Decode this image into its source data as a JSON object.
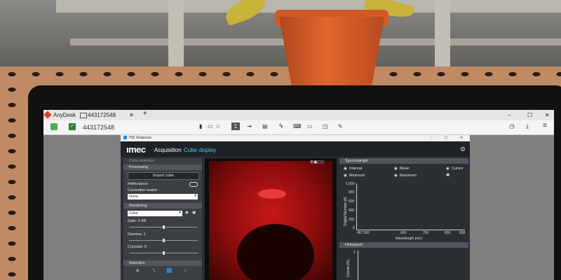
{
  "anydesk": {
    "app_name": "AnyDesk",
    "session_tab": "443172548",
    "address": "443172548",
    "new_tab": "+",
    "window_controls": [
      "–",
      "☐",
      "✕"
    ]
  },
  "app": {
    "window_title": "HSI Snapscan",
    "window_controls": [
      "–",
      "☐",
      "✕"
    ],
    "logo": "ımec",
    "tab_acquisition": "Acquisition",
    "tab_cube": "Cube display",
    "left": {
      "cube_selection": "Cube selection",
      "processing": "Processing",
      "export_button": "Export cube",
      "reflectance": "Reflectance",
      "correction_matrix": "Correction matrix:",
      "correction_value": "None",
      "rendering": "Rendering",
      "render_mode": "Color",
      "gain": "Gain: 0 dB",
      "gamma": "Gamma: 1",
      "contrast": "Contrast: 0",
      "selection": "Selection"
    },
    "right": {
      "spectrograph": "Spectrograph",
      "opt_interval": "Interval",
      "opt_mean": "Mean",
      "opt_cursor": "Cursor",
      "opt_minimum": "Minimum",
      "opt_maximum": "Maximum",
      "y_ticks": [
        "1,000",
        "800",
        "600",
        "400",
        "200",
        "0"
      ],
      "x_ticks": [
        "467 500",
        "600",
        "700",
        "800",
        "898"
      ],
      "y_label": "Digital Number (#)",
      "x_label": "Wavelength (nm)",
      "histogram": "Histogram",
      "hist_y_label": "Counts (%)",
      "hist_y_tick": "1"
    }
  }
}
